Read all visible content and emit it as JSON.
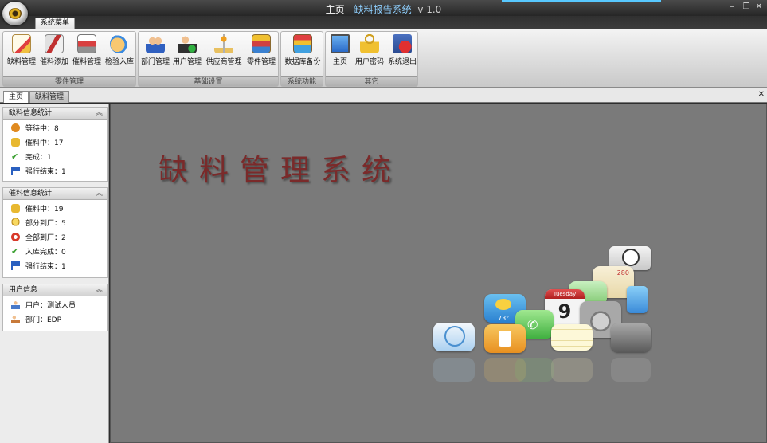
{
  "titlebar": {
    "page": "主页",
    "separator": " - ",
    "app_name": "缺料报告系统",
    "version": "v 1.0"
  },
  "ribbon": {
    "tab_label": "系统菜单",
    "groups": [
      {
        "caption": "零件管理",
        "buttons": [
          {
            "label": "缺料管理",
            "icon": "pencil-notepad-icon"
          },
          {
            "label": "催料添加",
            "icon": "megaphone-icon"
          },
          {
            "label": "催料管理",
            "icon": "printer-icon"
          },
          {
            "label": "检验入库",
            "icon": "hand-pointer-icon"
          }
        ]
      },
      {
        "caption": "基础设置",
        "buttons": [
          {
            "label": "部门管理",
            "icon": "users-group-icon"
          },
          {
            "label": "用户管理",
            "icon": "user-check-icon"
          },
          {
            "label": "供应商管理",
            "icon": "joystick-icon"
          },
          {
            "label": "零件管理",
            "icon": "parts-box-icon"
          }
        ]
      },
      {
        "caption": "系统功能",
        "buttons": [
          {
            "label": "数据库备份",
            "icon": "database-backup-icon"
          }
        ]
      },
      {
        "caption": "其它",
        "buttons": [
          {
            "label": "主页",
            "icon": "monitor-icon"
          },
          {
            "label": "用户密码",
            "icon": "lock-icon"
          },
          {
            "label": "系统退出",
            "icon": "exit-icon"
          }
        ]
      }
    ]
  },
  "doc_tabs": [
    "主页",
    "缺料管理"
  ],
  "left_panels": {
    "shortage_stats": {
      "title": "缺料信息统计",
      "rows": [
        {
          "text": "等待中：8",
          "icon": "medal-icon",
          "color": "#e08a20"
        },
        {
          "text": "催料中：17",
          "icon": "thumbs-up-icon",
          "color": "#e8b830"
        },
        {
          "text": "完成：1",
          "icon": "checkmark-icon",
          "color": "#3aa030"
        },
        {
          "text": "强行结束：1",
          "icon": "flag-icon",
          "color": "#2a60c0"
        }
      ]
    },
    "expedite_stats": {
      "title": "催料信息统计",
      "rows": [
        {
          "text": "催料中：19",
          "icon": "thumbs-up-icon",
          "color": "#e8b830"
        },
        {
          "text": "部分到厂：5",
          "icon": "lightbulb-icon",
          "color": "#f0c040"
        },
        {
          "text": "全部到厂：2",
          "icon": "alarm-clock-icon",
          "color": "#d83a2a"
        },
        {
          "text": "入库完成：0",
          "icon": "checkmark-icon",
          "color": "#3aa030"
        },
        {
          "text": "强行结束：1",
          "icon": "flag-icon",
          "color": "#2a60c0"
        }
      ]
    },
    "user_info": {
      "title": "用户信息",
      "rows": [
        {
          "text": "用户：测试人员",
          "icon": "user-icon",
          "color": "#4a7ac8"
        },
        {
          "text": "部门：EDP",
          "icon": "department-icon",
          "color": "#c87a3a"
        }
      ]
    }
  },
  "main": {
    "logo_text": "缺料管理系统",
    "calendar_day": "Tuesday",
    "calendar_date": "9",
    "weather_temp": "73°",
    "map_label": "280"
  },
  "colors": {
    "title_accent": "#8fd0ff",
    "main_bg": "#7a7a7a",
    "logo_text": "#7a2a2a"
  }
}
